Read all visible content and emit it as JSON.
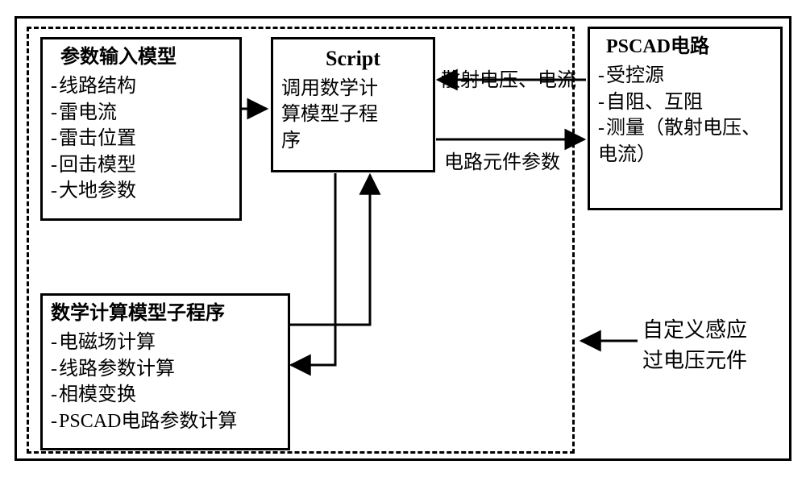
{
  "boxes": {
    "params": {
      "title": "参数输入模型",
      "items": [
        "线路结构",
        "雷电流",
        "雷击位置",
        "回击模型",
        "大地参数"
      ]
    },
    "script": {
      "title": "Script",
      "body_l1": "调用数学计",
      "body_l2": "算模型子程",
      "body_l3": "序"
    },
    "math": {
      "title": "数学计算模型子程序",
      "items": [
        "电磁场计算",
        "线路参数计算",
        "相模变换",
        "PSCAD电路参数计算"
      ]
    },
    "pscad": {
      "title": "PSCAD电路",
      "items": [
        "受控源",
        "自阻、互阻",
        "测量（散射电压、电流）"
      ]
    }
  },
  "edges": {
    "top": "散射电压、电流",
    "bottom": "电路元件参数"
  },
  "caption": {
    "l1": "自定义感应",
    "l2": "过电压元件"
  }
}
